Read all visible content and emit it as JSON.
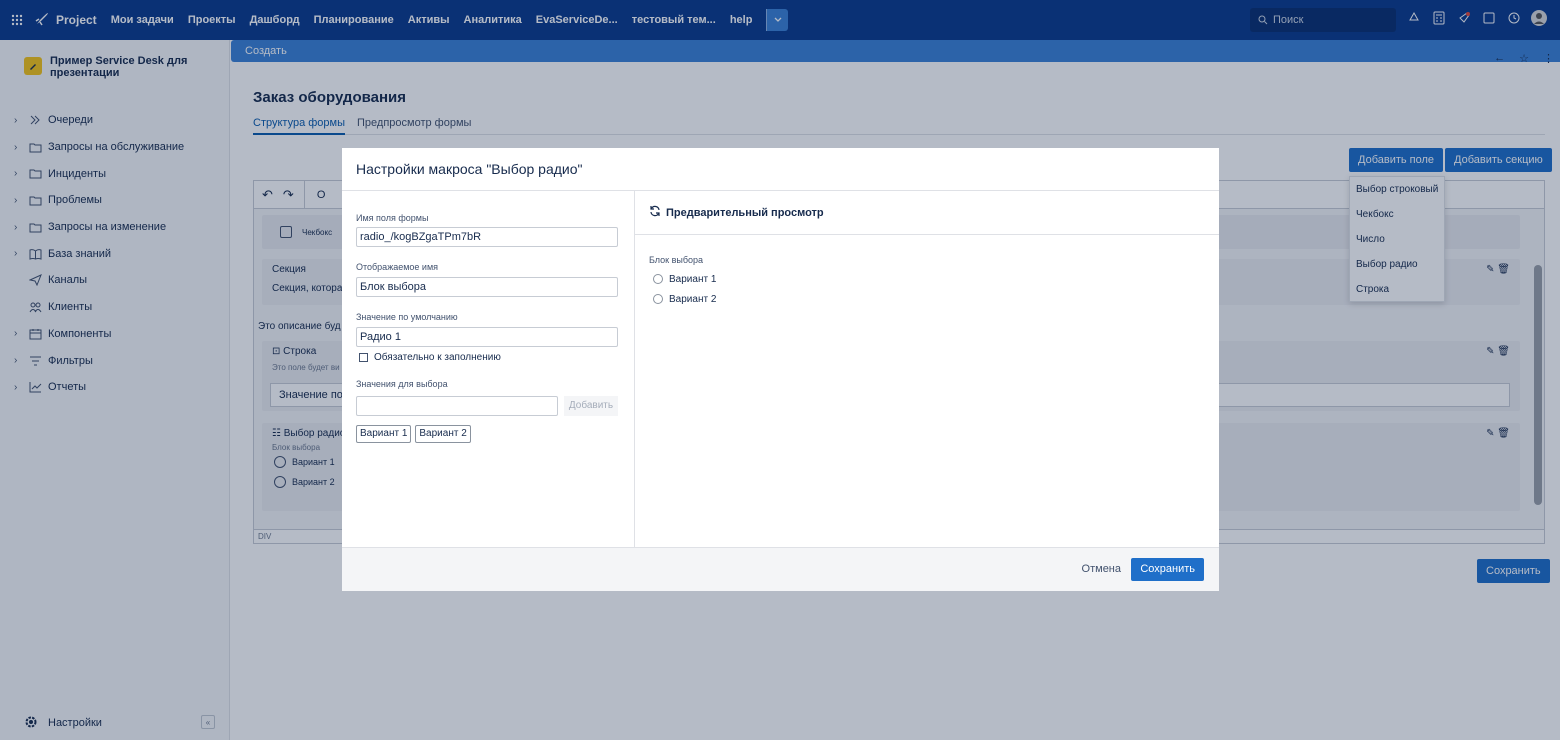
{
  "topbar": {
    "brand": "Project",
    "nav": [
      "Мои задачи",
      "Проекты",
      "Дашборд",
      "Планирование",
      "Активы",
      "Аналитика",
      "EvaServiceDe...",
      "тестовый тем...",
      "help"
    ],
    "create_label": "Создать",
    "search_placeholder": "Поиск",
    "colors": {
      "bar": "#0b3a8c",
      "accent": "#3b82d6"
    }
  },
  "sidebar": {
    "project_name": "Пример Service Desk для презентации",
    "items": [
      {
        "label": "Очереди",
        "icon": "double-chevron-icon",
        "expandable": true
      },
      {
        "label": "Запросы на обслуживание",
        "icon": "folder-icon",
        "expandable": true
      },
      {
        "label": "Инциденты",
        "icon": "folder-icon",
        "expandable": true
      },
      {
        "label": "Проблемы",
        "icon": "folder-icon",
        "expandable": true
      },
      {
        "label": "Запросы на изменение",
        "icon": "folder-icon",
        "expandable": true
      },
      {
        "label": "База знаний",
        "icon": "book-icon",
        "expandable": true
      },
      {
        "label": "Каналы",
        "icon": "send-icon",
        "expandable": false
      },
      {
        "label": "Клиенты",
        "icon": "users-icon",
        "expandable": false
      },
      {
        "label": "Компоненты",
        "icon": "calendar-icon",
        "expandable": true
      },
      {
        "label": "Фильтры",
        "icon": "filter-icon",
        "expandable": true
      },
      {
        "label": "Отчеты",
        "icon": "chart-icon",
        "expandable": true
      }
    ],
    "settings_label": "Настройки"
  },
  "main": {
    "title": "Заказ оборудования",
    "tabs": [
      {
        "label": "Структура формы",
        "active": true
      },
      {
        "label": "Предпросмотр формы",
        "active": false
      }
    ],
    "add_field_label": "Добавить поле",
    "add_section_label": "Добавить секцию",
    "save_label": "Сохранить",
    "add_field_menu": [
      "Выбор строковый",
      "Чекбокс",
      "Число",
      "Выбор радио",
      "Строка"
    ],
    "editor": {
      "toolbar_text": "O",
      "checkbox_label": "Чекбокс",
      "section_title": "Секция",
      "section_desc": "Секция, котора",
      "description_text": "Это описание буд",
      "string_block": {
        "title": "Строка",
        "hint": "Это поле будет ви",
        "default_value": "Значение по"
      },
      "radio_block": {
        "title": "Выбор радио",
        "label": "Блок выбора",
        "options": [
          "Вариант 1",
          "Вариант 2"
        ]
      },
      "status": "DIV"
    }
  },
  "modal": {
    "title": "Настройки макроса \"Выбор радио\"",
    "field_name_label": "Имя поля формы",
    "field_name_value": "radio_/kogBZgaTPm7bR",
    "display_name_label": "Отображаемое имя",
    "display_name_value": "Блок выбора",
    "default_label": "Значение по умолчанию",
    "default_value": "Радио 1",
    "required_label": "Обязательно к заполнению",
    "values_label": "Значения для выбора",
    "values_input": "",
    "add_label": "Добавить",
    "chips": [
      "Вариант 1",
      "Вариант 2"
    ],
    "preview_title": "Предварительный просмотр",
    "preview_label": "Блок выбора",
    "preview_options": [
      "Вариант 1",
      "Вариант 2"
    ],
    "cancel_label": "Отмена",
    "save_label": "Сохранить"
  }
}
